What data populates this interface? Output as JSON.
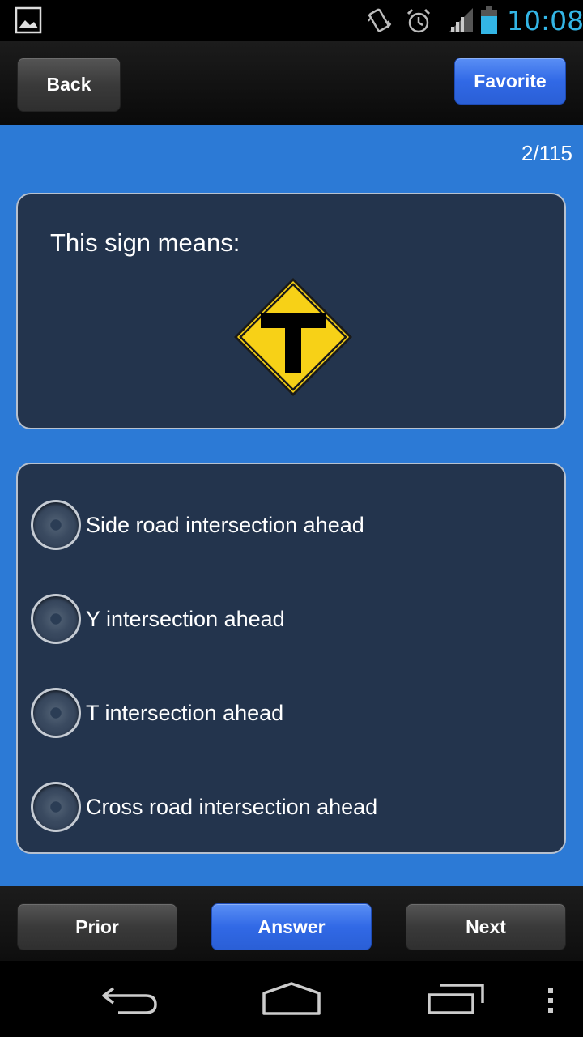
{
  "status_bar": {
    "time": "10:08",
    "time_color": "#33b5e5",
    "icons": [
      "gallery-notification-icon",
      "vibrate-icon",
      "alarm-icon",
      "signal-icon",
      "battery-icon"
    ]
  },
  "top_bar": {
    "back_label": "Back",
    "favorite_label": "Favorite"
  },
  "quiz": {
    "counter": "2/115",
    "question": "This sign means:",
    "sign_icon": "t-intersection-sign-icon",
    "options": [
      {
        "label": "Side road intersection ahead",
        "selected": false
      },
      {
        "label": "Y intersection ahead",
        "selected": false
      },
      {
        "label": "T intersection ahead",
        "selected": false
      },
      {
        "label": "Cross road intersection ahead",
        "selected": false
      }
    ]
  },
  "bottom_bar": {
    "prior_label": "Prior",
    "answer_label": "Answer",
    "next_label": "Next"
  },
  "colors": {
    "background": "#2c7ad6",
    "panel": "#23344d",
    "accent_button": "#3169e6",
    "sign_yellow": "#f7d117"
  },
  "nav_bar": {
    "icons": [
      "back-nav-icon",
      "home-nav-icon",
      "recent-apps-icon",
      "overflow-menu-icon"
    ]
  }
}
